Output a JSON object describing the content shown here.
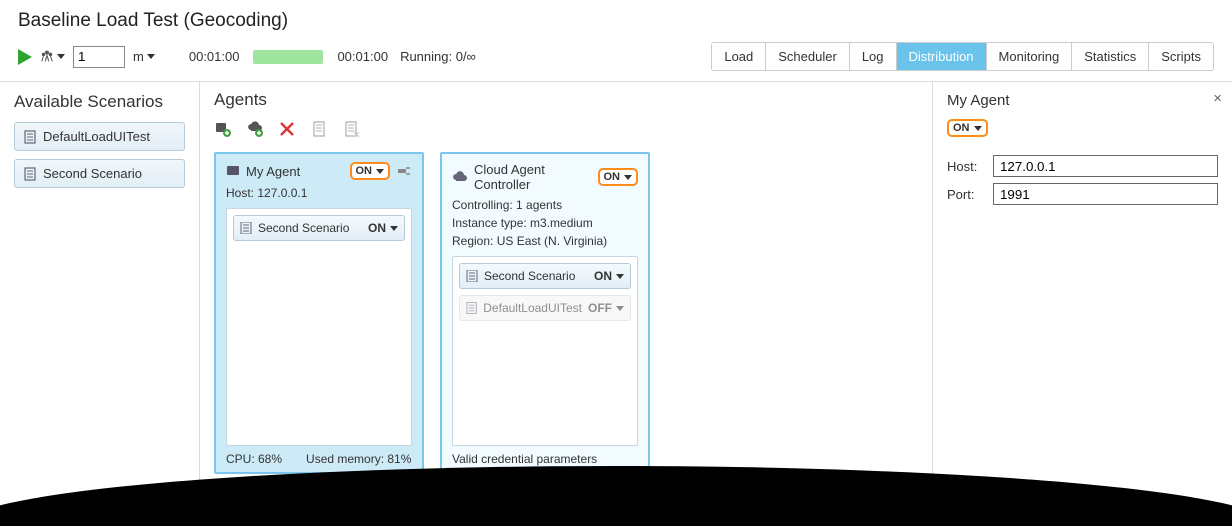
{
  "title": "Baseline Load Test (Geocoding)",
  "toolbar": {
    "duration_value": "1",
    "duration_unit": "m",
    "elapsed": "00:01:00",
    "total": "00:01:00",
    "running_label": "Running: 0/∞"
  },
  "tabs": [
    "Load",
    "Scheduler",
    "Log",
    "Distribution",
    "Monitoring",
    "Statistics",
    "Scripts"
  ],
  "active_tab_index": 3,
  "sidebar": {
    "title": "Available Scenarios",
    "items": [
      "DefaultLoadUITest",
      "Second Scenario"
    ]
  },
  "agents_panel": {
    "title": "Agents"
  },
  "agents": [
    {
      "name": "My Agent",
      "status": "ON",
      "host_line": "Host: 127.0.0.1",
      "scenarios": [
        {
          "label": "Second Scenario",
          "state": "ON",
          "disabled": false
        }
      ],
      "footer": "CPU: 68%    Used memory: 81%"
    },
    {
      "name": "Cloud Agent Controller",
      "status": "ON",
      "meta": [
        "Controlling: 1 agents",
        "Instance type: m3.medium",
        "Region: US East (N. Virginia)"
      ],
      "scenarios": [
        {
          "label": "Second Scenario",
          "state": "ON",
          "disabled": false
        },
        {
          "label": "DefaultLoadUITest",
          "state": "OFF",
          "disabled": true
        }
      ],
      "footer": "Valid credential parameters"
    }
  ],
  "props": {
    "title": "My Agent",
    "status": "ON",
    "host_label": "Host:",
    "host_value": "127.0.0.1",
    "port_label": "Port:",
    "port_value": "1991"
  }
}
